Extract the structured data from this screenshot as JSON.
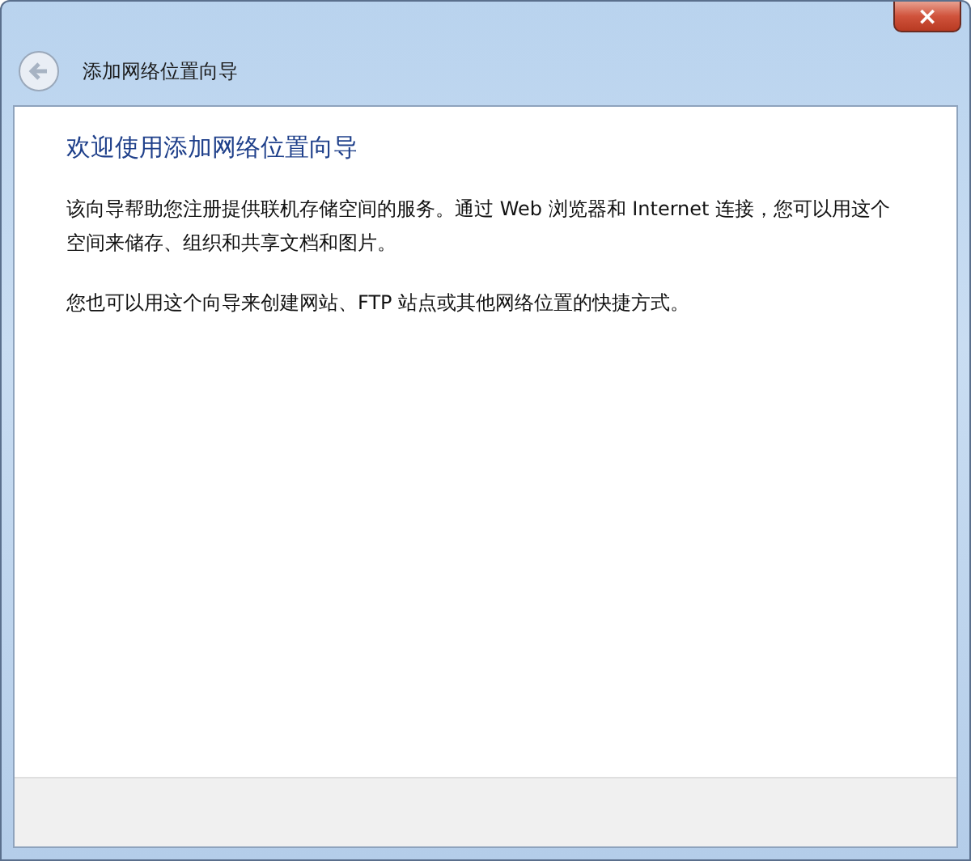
{
  "window": {
    "title": "添加网络位置向导",
    "close_button": "×"
  },
  "heading": "欢迎使用添加网络位置向导",
  "paragraphs": [
    "该向导帮助您注册提供联机存储空间的服务。通过 Web 浏览器和 Internet 连接，您可以用这个空间来储存、组织和共享文档和图片。",
    "您也可以用这个向导来创建网站、FTP 站点或其他网络位置的快捷方式。"
  ]
}
